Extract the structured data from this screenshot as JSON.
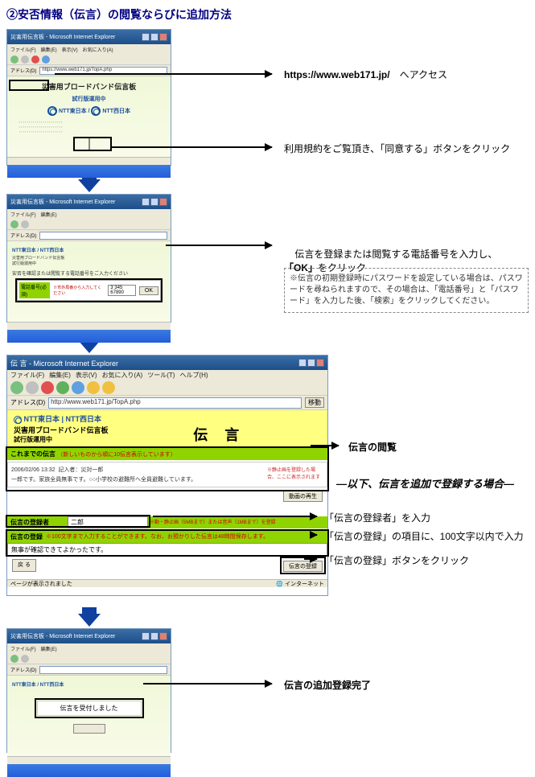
{
  "title": "②安否情報（伝言）の閲覧ならびに追加方法",
  "browser": {
    "window_title": "災害用伝言板 - Microsoft Internet Explorer",
    "menus": [
      "ファイル(F)",
      "編集(E)",
      "表示(V)",
      "お気に入り(A)",
      "ツール(T)",
      "ヘルプ(H)"
    ],
    "address_label": "アドレス(D)",
    "url": "https://www.web171.jp/TopA.php",
    "status_left": "ページが表示されました",
    "status_right": "インターネット"
  },
  "step1": {
    "brand_main": "災害用ブロードバンド伝言板",
    "brand_sub": "試行版運用中",
    "ntt_east": "NTT東日本",
    "ntt_west": "NTT西日本",
    "annot_url": "https://www.web171.jp/",
    "annot_url_tail": "　へアクセス",
    "annot_agree": "利用規約をご覧頂き、「同意する」ボタンをクリック"
  },
  "step2": {
    "small_ntt": "NTT東日本 / NTT西日本",
    "small_brand": "災害用ブロードバンド伝言板\n試行版運用中",
    "phone_label": "電話番号(必須)",
    "phone_sample": "3  345  67890",
    "ok": "OK",
    "annot_main": "伝言を登録または閲覧する電話番号を入力し、\n「OK」をクリック",
    "note": "※伝言の初期登録時にパスワードを設定している場合は、パスワードを尋ねられますので、その場合は、「電話番号」と「パスワード」を入力した後、「検索」をクリックしてください。"
  },
  "step3": {
    "brand_top": "NTT東日本 | NTT西日本",
    "brand_sub1": "災害用ブロードバンド伝言板",
    "brand_sub2": "試行版運用中",
    "heading": "伝 言",
    "green1_label": "これまでの伝言",
    "green1_note": "（新しいものから順に10伝言表示しています）",
    "msg_time": "2006/02/06 13:32",
    "msg_who_label": "記入者：",
    "msg_who": "災対一郎",
    "msg_body": "一郎です。家族全員無事です。○○小学校の避難所へ全員避難しています。",
    "side_note": "※静止画を登録した場合、ここに表示されます",
    "play_btn": "動画の再生",
    "green2": "伝言の登録者",
    "sample_name": "二郎",
    "green3_left": "伝言の登録",
    "green3_right": "※100文字まで入力することができます。なお、お預かりした伝言は48時間保存します。",
    "input_sample": "無事が確認できてよかったです。",
    "back_btn": "戻 る",
    "submit_btn": "伝言の登録",
    "annot_view": "伝言の閲覧",
    "annot_head": "―以下、伝言を追加で登録する場合―",
    "annot_a": "「伝言の登録者」を入力",
    "annot_b": "「伝言の登録」の項目に、100文字以内で入力",
    "annot_c": "「伝言の登録」ボタンをクリック"
  },
  "step4": {
    "msg": "伝言を受付しました",
    "annot": "伝言の追加登録完了"
  }
}
